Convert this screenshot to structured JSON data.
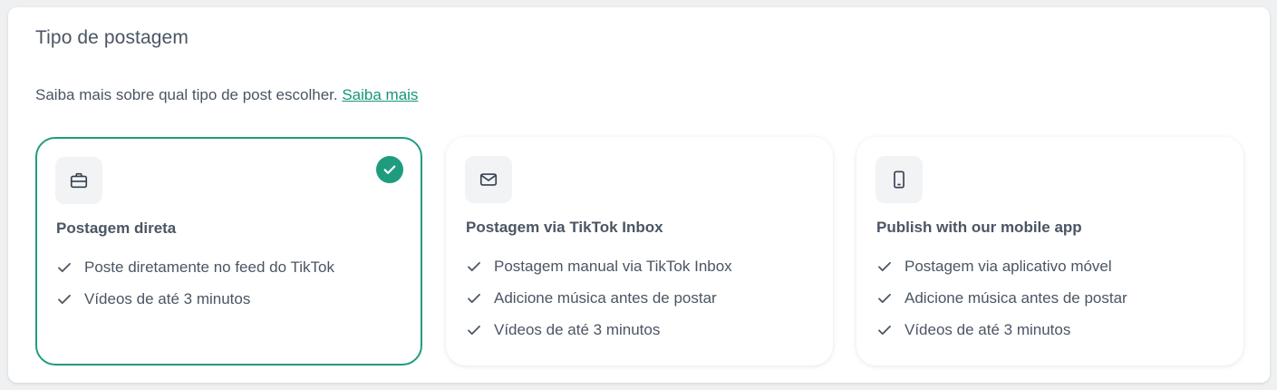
{
  "section": {
    "title": "Tipo de postagem",
    "subtitle_text": "Saiba mais sobre qual tipo de post escolher.",
    "learn_more_link": "Saiba mais"
  },
  "cards": [
    {
      "icon": "briefcase-icon",
      "title": "Postagem direta",
      "selected": true,
      "features": [
        "Poste diretamente no feed do TikTok",
        "Vídeos de até 3 minutos"
      ]
    },
    {
      "icon": "mail-icon",
      "title": "Postagem via TikTok Inbox",
      "selected": false,
      "features": [
        "Postagem manual via TikTok Inbox",
        "Adicione música antes de postar",
        "Vídeos de até 3 minutos"
      ]
    },
    {
      "icon": "smartphone-icon",
      "title": "Publish with our mobile app",
      "selected": false,
      "features": [
        "Postagem via aplicativo móvel",
        "Adicione música antes de postar",
        "Vídeos de até 3 minutos"
      ]
    }
  ],
  "colors": {
    "accent": "#1f9c7e",
    "text": "#4b5563",
    "icon_bg": "#f1f3f5"
  }
}
